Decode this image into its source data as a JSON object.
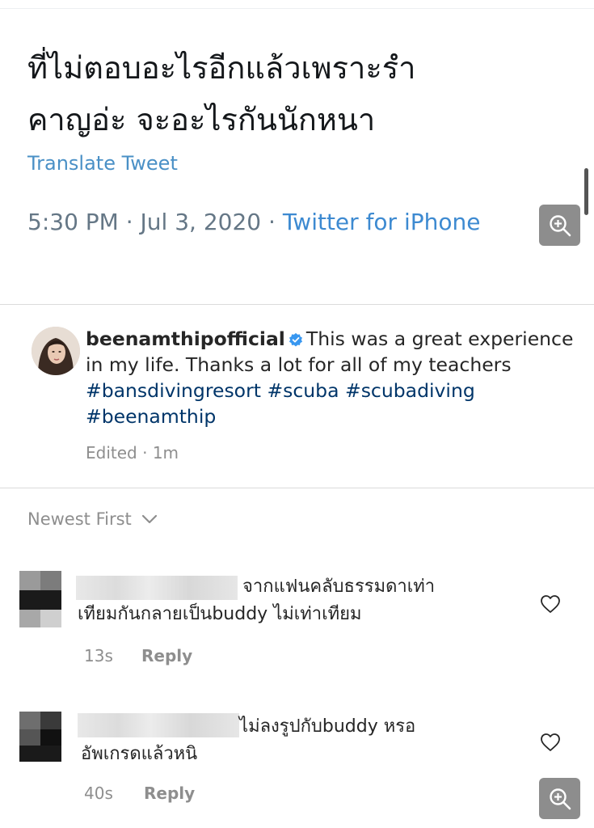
{
  "tweet": {
    "text_line1": "ที่ไม่ตอบอะไรอีกแล้วเพราะรำ",
    "text_line2": "คาญอ่ะ จะอะไรกันนักหนา",
    "translate_label": "Translate Tweet",
    "time": "5:30 PM",
    "date": "Jul 3, 2020",
    "source": "Twitter for iPhone",
    "separator": "·"
  },
  "post": {
    "username": "beenamthipofficial",
    "caption_text": "This was a great experience in my life. Thanks a lot for all of my teachers",
    "hashtags": [
      "#bansdivingresort",
      "#scuba",
      "#scubadiving",
      "#beenamthip"
    ],
    "edited_label": "Edited",
    "edited_time": "1m",
    "separator": "·"
  },
  "comments_header": {
    "sort_label": "Newest First"
  },
  "comments": [
    {
      "line1": "จากแฟนคลับธรรมดาเท่า",
      "line2": "เทียมกันกลายเป็นbuddy ไม่เท่าเทียม",
      "time": "13s",
      "reply_label": "Reply"
    },
    {
      "line1": "ไม่ลงรูปกับbuddy หรอ",
      "line2": "อัพเกรดแล้วหนิ",
      "time": "40s",
      "reply_label": "Reply"
    }
  ],
  "colors": {
    "link_blue": "#3d8ad1",
    "hashtag": "#003569",
    "verified": "#3897f0",
    "secondary": "#8e8e8e"
  }
}
